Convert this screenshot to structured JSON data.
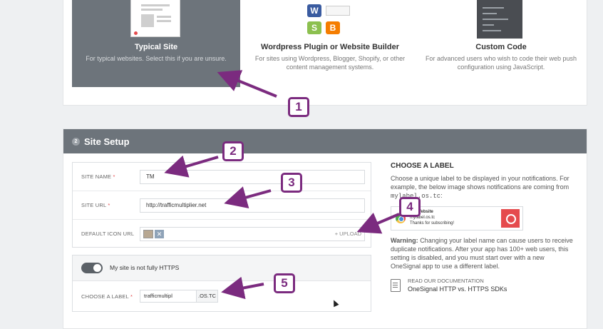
{
  "site_types": [
    {
      "title": "Typical Site",
      "desc": "For typical websites. Select this if you are unsure.",
      "selected": true,
      "illustration": "webpage-illustration"
    },
    {
      "title": "Wordpress Plugin or Website Builder",
      "desc": "For sites using Wordpress, Blogger, Shopify, or other content management systems.",
      "selected": false,
      "illustration": "cms-logos-illustration"
    },
    {
      "title": "Custom Code",
      "desc": "For advanced users who wish to code their web push configuration using JavaScript.",
      "selected": false,
      "illustration": "code-editor-illustration"
    }
  ],
  "site_setup": {
    "step": "2",
    "title": "Site Setup",
    "fields": {
      "site_name": {
        "label": "SITE NAME",
        "value": "TM"
      },
      "site_url": {
        "label": "SITE URL",
        "value": "http://trafficmultiplier.net"
      },
      "default_icon": {
        "label": "DEFAULT ICON URL",
        "remove_glyph": "✕",
        "upload_label": "+ UPLOAD"
      }
    },
    "https_toggle": {
      "label": "My site is not fully HTTPS",
      "on": true
    },
    "choose_label": {
      "label": "CHOOSE A LABEL",
      "value": "trafficmultipl",
      "suffix": ".OS.TC"
    },
    "required_mark": "*"
  },
  "help": {
    "title": "CHOOSE A LABEL",
    "intro": "Choose a unique label to be displayed in your notifications. For example, the below image shows notifications are coming from",
    "example_domain": "mylabel.os.tc",
    "intro_end": ":",
    "notification": {
      "site": "My Website",
      "domain": "mylabel.os.tc",
      "message": "Thanks for subscribing!"
    },
    "warning_bold": "Warning:",
    "warning_text": "Changing your label name can cause users to receive duplicate notifications. After your app has 100+ web users, this setting is disabled, and you must start over with a new OneSignal app to use a different label.",
    "doc_kicker": "READ OUR DOCUMENTATION",
    "doc_link": "OneSignal HTTP vs. HTTPS SDKs"
  },
  "callouts": [
    "1",
    "2",
    "3",
    "4",
    "5"
  ],
  "colors": {
    "accent": "#7b2b7f",
    "header": "#6d747b",
    "required": "#e54b4d"
  }
}
